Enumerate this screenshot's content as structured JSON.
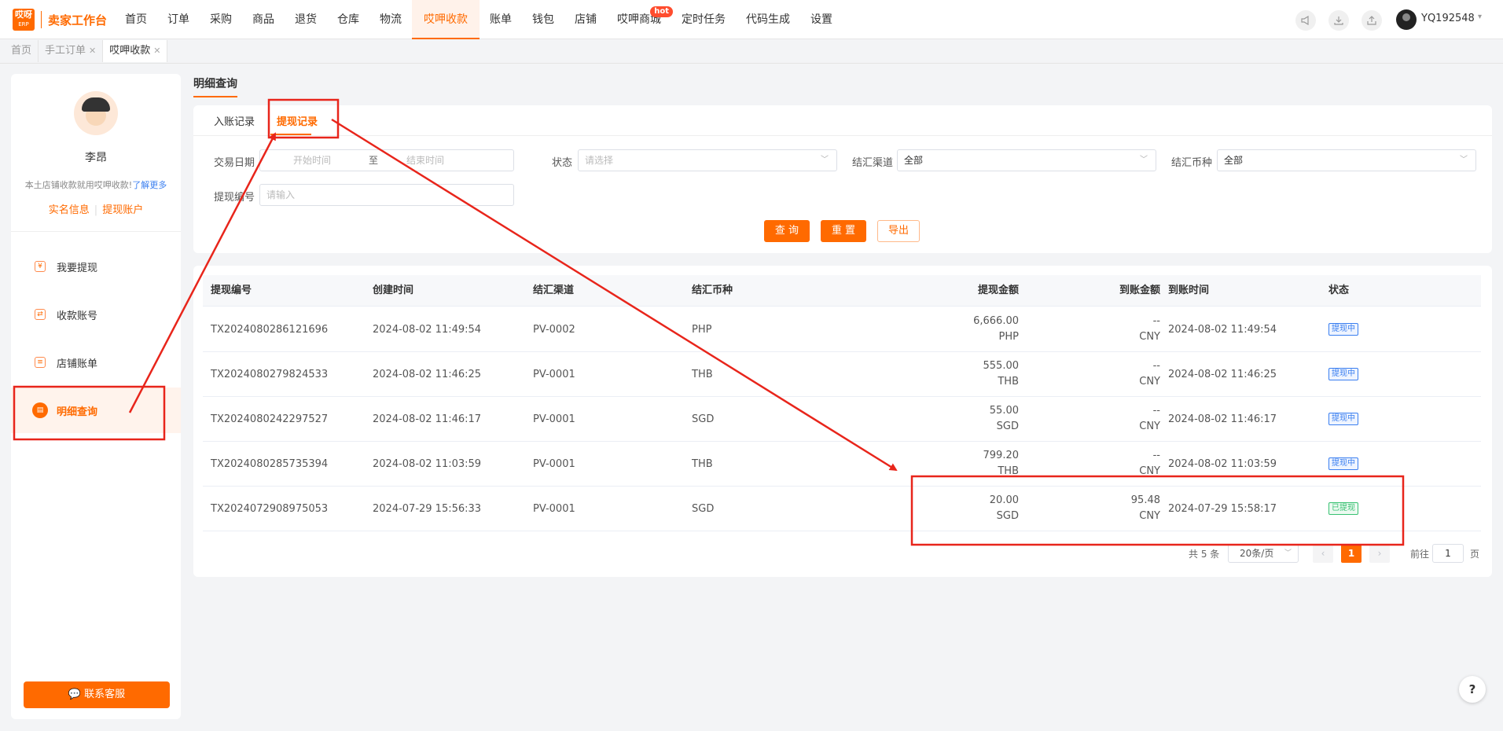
{
  "app": {
    "logo_badge": "哎呀",
    "logo_badge_sub": "ERP",
    "logo_text": "卖家工作台"
  },
  "nav": {
    "items": [
      "首页",
      "订单",
      "采购",
      "商品",
      "退货",
      "仓库",
      "物流",
      "哎呷收款",
      "账单",
      "钱包",
      "店铺",
      "哎呷商城",
      "定时任务",
      "代码生成",
      "设置"
    ],
    "active": "哎呷收款",
    "hot_badge": "hot",
    "user": "YQ192548",
    "tool_icons": [
      "megaphone-icon",
      "download-icon",
      "share-icon"
    ]
  },
  "page_tabs": [
    {
      "label": "首页",
      "closable": false
    },
    {
      "label": "手工订单",
      "closable": true
    },
    {
      "label": "哎呷收款",
      "closable": true,
      "active": true
    }
  ],
  "sidebar": {
    "name": "李昂",
    "desc": "本土店铺收款就用哎呷收款!",
    "more_link": "了解更多",
    "links": [
      "实名信息",
      "提现账户"
    ],
    "items": [
      {
        "label": "我要提现",
        "icon": "withdraw-icon"
      },
      {
        "label": "收款账号",
        "icon": "account-icon"
      },
      {
        "label": "店铺账单",
        "icon": "bill-icon"
      },
      {
        "label": "明细查询",
        "icon": "detail-icon",
        "active": true
      }
    ],
    "contact_button": "联系客服"
  },
  "page_title": "明细查询",
  "filter": {
    "tabs": [
      "入账记录",
      "提现记录"
    ],
    "active_tab": "提现记录",
    "date_label": "交易日期",
    "date_start_placeholder": "开始时间",
    "date_sep": "至",
    "date_end_placeholder": "结束时间",
    "status_label": "状态",
    "status_placeholder": "请选择",
    "channel_label": "结汇渠道",
    "channel_value": "全部",
    "currency_label": "结汇币种",
    "currency_value": "全部",
    "withdraw_no_label": "提现编号",
    "withdraw_no_placeholder": "请输入",
    "query_button": "查 询",
    "reset_button": "重 置",
    "export_button": "导出"
  },
  "table": {
    "columns": [
      "提现编号",
      "创建时间",
      "结汇渠道",
      "结汇币种",
      "提现金额",
      "到账金额",
      "到账时间",
      "状态"
    ],
    "rows": [
      {
        "id": "TX2024080286121696",
        "created": "2024-08-02 11:49:54",
        "channel": "PV-0002",
        "currency": "PHP",
        "amount": "6,666.00",
        "amount_cur": "PHP",
        "received": "--",
        "received_cur": "CNY",
        "received_time": "2024-08-02 11:49:54",
        "status": "提现中",
        "status_type": "pending"
      },
      {
        "id": "TX2024080279824533",
        "created": "2024-08-02 11:46:25",
        "channel": "PV-0001",
        "currency": "THB",
        "amount": "555.00",
        "amount_cur": "THB",
        "received": "--",
        "received_cur": "CNY",
        "received_time": "2024-08-02 11:46:25",
        "status": "提现中",
        "status_type": "pending"
      },
      {
        "id": "TX2024080242297527",
        "created": "2024-08-02 11:46:17",
        "channel": "PV-0001",
        "currency": "SGD",
        "amount": "55.00",
        "amount_cur": "SGD",
        "received": "--",
        "received_cur": "CNY",
        "received_time": "2024-08-02 11:46:17",
        "status": "提现中",
        "status_type": "pending"
      },
      {
        "id": "TX2024080285735394",
        "created": "2024-08-02 11:03:59",
        "channel": "PV-0001",
        "currency": "THB",
        "amount": "799.20",
        "amount_cur": "THB",
        "received": "--",
        "received_cur": "CNY",
        "received_time": "2024-08-02 11:03:59",
        "status": "提现中",
        "status_type": "pending"
      },
      {
        "id": "TX2024072908975053",
        "created": "2024-07-29 15:56:33",
        "channel": "PV-0001",
        "currency": "SGD",
        "amount": "20.00",
        "amount_cur": "SGD",
        "received": "95.48",
        "received_cur": "CNY",
        "received_time": "2024-07-29 15:58:17",
        "status": "已提现",
        "status_type": "done"
      }
    ]
  },
  "pagination": {
    "total": "共 5 条",
    "page_size": "20条/页",
    "current_page": "1",
    "goto_label": "前往",
    "goto_value": "1",
    "goto_unit": "页"
  },
  "help": "?",
  "colors": {
    "accent": "#ff6a00",
    "annotation": "#e8251b",
    "status_pending": "#3b7ff0",
    "status_done": "#38c172"
  }
}
